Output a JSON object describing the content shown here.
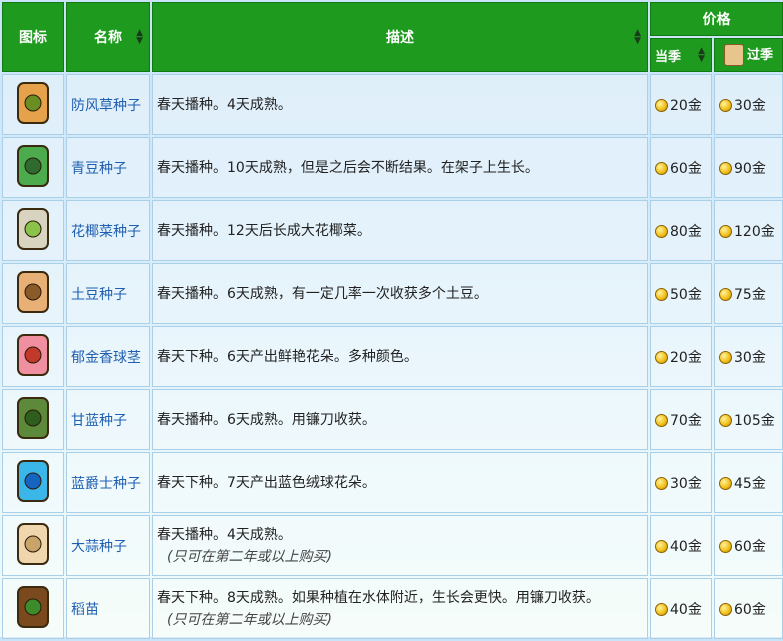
{
  "headers": {
    "icon": "图标",
    "name": "名称",
    "desc": "描述",
    "price": "价格",
    "in_season": "当季",
    "out_season": "过季"
  },
  "rows": [
    {
      "name": "防风草种子",
      "desc": "春天播种。4天成熟。",
      "note": "",
      "price": "20金",
      "off": "30金",
      "color": "#e6a24b",
      "seed": "#6b8e23"
    },
    {
      "name": "青豆种子",
      "desc": "春天播种。10天成熟，但是之后会不断结果。在架子上生长。",
      "note": "",
      "price": "60金",
      "off": "90金",
      "color": "#4cab4c",
      "seed": "#2f6b2f"
    },
    {
      "name": "花椰菜种子",
      "desc": "春天播种。12天后长成大花椰菜。",
      "note": "",
      "price": "80金",
      "off": "120金",
      "color": "#d8d4c0",
      "seed": "#8bc34a"
    },
    {
      "name": "土豆种子",
      "desc": "春天播种。6天成熟，有一定几率一次收获多个土豆。",
      "note": "",
      "price": "50金",
      "off": "75金",
      "color": "#e8b074",
      "seed": "#8b5a2b"
    },
    {
      "name": "郁金香球茎",
      "desc": "春天下种。6天产出鲜艳花朵。多种颜色。",
      "note": "",
      "price": "20金",
      "off": "30金",
      "color": "#f08fa0",
      "seed": "#c0392b"
    },
    {
      "name": "甘蓝种子",
      "desc": "春天播种。6天成熟。用镰刀收获。",
      "note": "",
      "price": "70金",
      "off": "105金",
      "color": "#5d8a3a",
      "seed": "#2e5e1e"
    },
    {
      "name": "蓝爵士种子",
      "desc": "春天下种。7天产出蓝色绒球花朵。",
      "note": "",
      "price": "30金",
      "off": "45金",
      "color": "#3ab7e8",
      "seed": "#1565c0"
    },
    {
      "name": "大蒜种子",
      "desc": "春天播种。4天成熟。",
      "note": "(只可在第二年或以上购买)",
      "price": "40金",
      "off": "60金",
      "color": "#f0d6ad",
      "seed": "#c9a46a"
    },
    {
      "name": "稻苗",
      "desc": "春天下种。8天成熟。如果种植在水体附近，生长会更快。用镰刀收获。",
      "note": "(只可在第二年或以上购买)",
      "price": "40金",
      "off": "60金",
      "color": "#7a4a1e",
      "seed": "#3c8c2c"
    }
  ]
}
